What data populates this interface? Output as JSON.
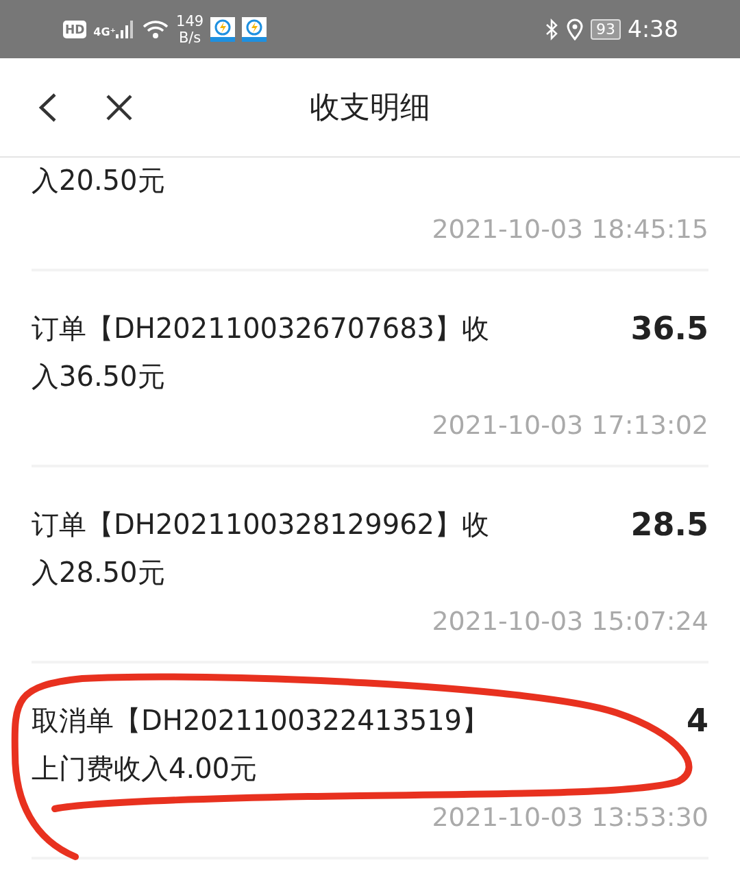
{
  "status_bar": {
    "hd": "HD",
    "network": "4G⁺",
    "speed_value": "149",
    "speed_unit": "B/s",
    "battery": "93",
    "time": "4:38"
  },
  "header": {
    "title": "收支明细"
  },
  "entries": [
    {
      "description": "入20.50元",
      "time": "2021-10-03 18:45:15"
    },
    {
      "description": "订单【DH2021100326707683】收入36.50元",
      "amount": "36.5",
      "time": "2021-10-03 17:13:02"
    },
    {
      "description": "订单【DH2021100328129962】收入28.50元",
      "amount": "28.5",
      "time": "2021-10-03 15:07:24"
    },
    {
      "description": "取消单【DH2021100322413519】上门费收入4.00元",
      "amount": "4",
      "time": "2021-10-03 13:53:30"
    }
  ],
  "annotation": {
    "kind": "circled"
  }
}
